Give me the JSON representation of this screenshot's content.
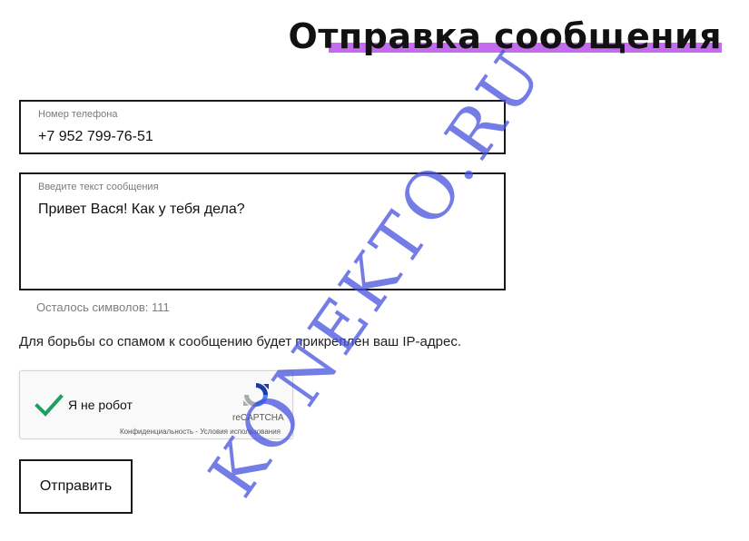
{
  "header": {
    "title": "Отправка сообщения",
    "accent_color": "#c56bf0"
  },
  "form": {
    "phone": {
      "label": "Номер телефона",
      "value": "+7 952 799-76-51"
    },
    "message": {
      "label": "Введите текст сообщения",
      "value": "Привет Вася! Как у тебя дела?"
    },
    "counter": "Осталось символов: 111",
    "spam_note": "Для борьбы со спамом к сообщению будет прикреплен ваш IP-адрес."
  },
  "captcha": {
    "checked": true,
    "label": "Я не робот",
    "brand": "reCAPTCHA",
    "links": "Конфиденциальность - Условия использования",
    "check_color": "#1e9e62"
  },
  "actions": {
    "submit_label": "Отправить"
  },
  "watermark": {
    "text": "KONEKTO.RU",
    "color": "#4650dc"
  }
}
